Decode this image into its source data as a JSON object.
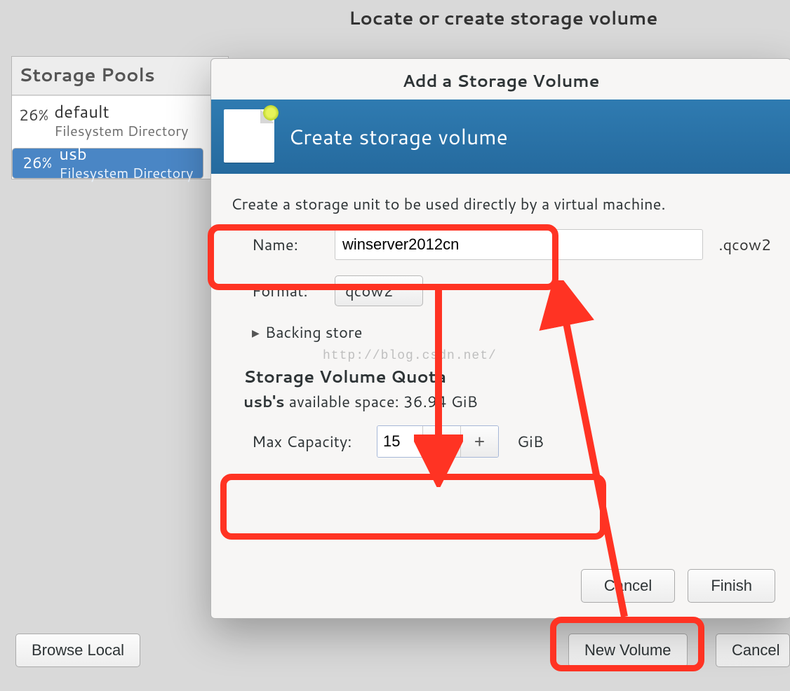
{
  "page": {
    "title": "Locate or create storage volume"
  },
  "pools": {
    "header": "Storage Pools",
    "items": [
      {
        "percent": "26%",
        "name": "default",
        "sub": "Filesystem Directory"
      },
      {
        "percent": "26%",
        "name": "usb",
        "sub": "Filesystem Directory"
      }
    ]
  },
  "buttons": {
    "browse_local": "Browse Local",
    "new_volume": "New Volume",
    "cancel": "Cancel"
  },
  "dialog": {
    "title": "Add a Storage Volume",
    "banner": "Create storage volume",
    "lead": "Create a storage unit to be used directly by a virtual machine.",
    "name_label": "Name:",
    "name_value": "winserver2012cn",
    "name_suffix": ".qcow2",
    "format_label": "Format:",
    "format_value": "qcow2",
    "backing": "Backing store",
    "quota_title": "Storage Volume Quota",
    "quota_pool": "usb's",
    "quota_avail_text": "available space: 36.94 GiB",
    "max_label": "Max Capacity:",
    "max_value": "15",
    "unit": "GiB",
    "cancel": "Cancel",
    "finish": "Finish"
  },
  "watermark": "http://blog.csdn.net/"
}
